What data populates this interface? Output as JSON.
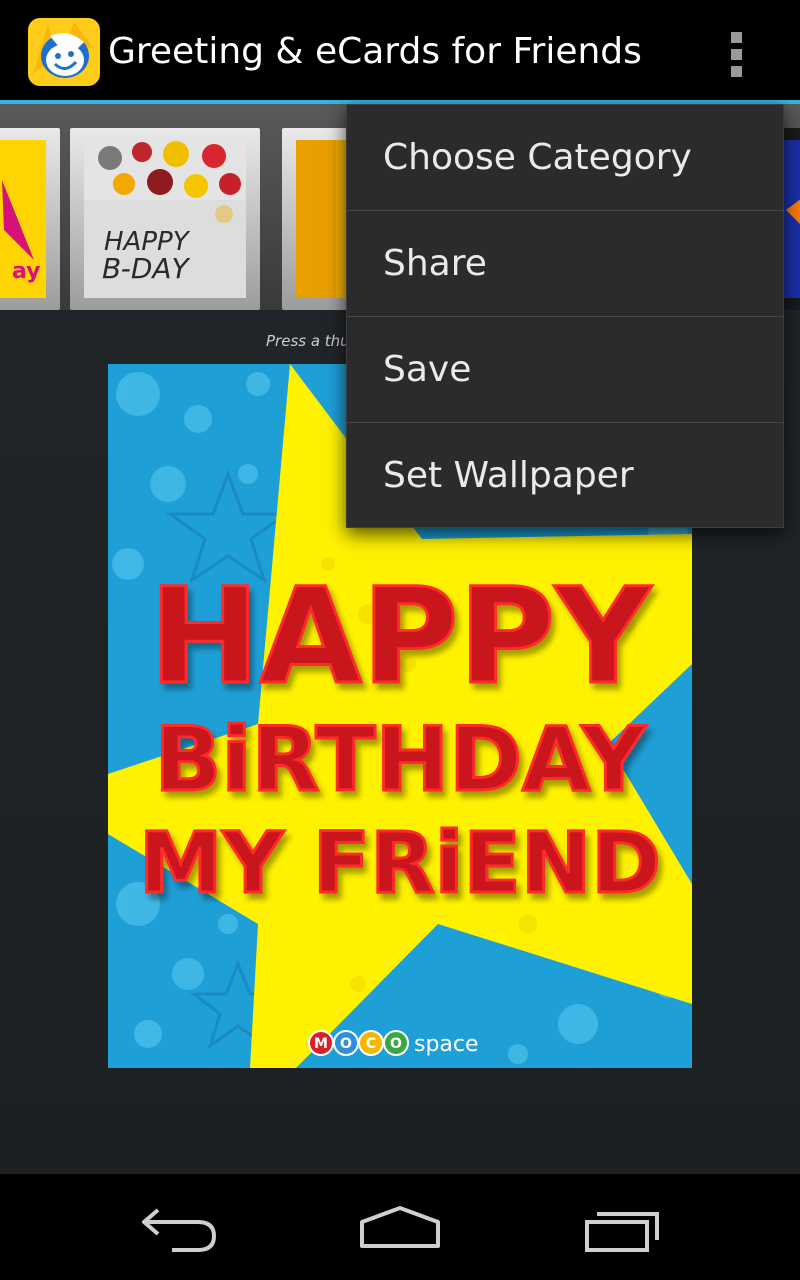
{
  "app": {
    "title": "Greeting & eCards for Friends",
    "icon": "moco-face-icon",
    "accent": "#33b5e5"
  },
  "hint": "Press a thu",
  "thumbnails": [
    {
      "icon": "thumbnail-happy-birthday-partial"
    },
    {
      "icon": "thumbnail-happy-bday",
      "text_lines": [
        "HAPPY",
        "B-DAY"
      ]
    },
    {
      "icon": "thumbnail-orange-card"
    }
  ],
  "card": {
    "lines": [
      "HAPPY",
      "BiRTHDAY",
      "MY FRiEND"
    ],
    "brand_letters": [
      "M",
      "O",
      "C",
      "O"
    ],
    "brand_suffix": "space",
    "colors": {
      "background": "#1e9fd6",
      "star": "#fff200",
      "text": "#c8141c"
    }
  },
  "menu": {
    "items": [
      {
        "label": "Choose Category"
      },
      {
        "label": "Share"
      },
      {
        "label": "Save"
      },
      {
        "label": "Set Wallpaper"
      }
    ]
  },
  "navigation": {
    "buttons": [
      "back-icon",
      "home-icon",
      "recent-apps-icon"
    ]
  }
}
